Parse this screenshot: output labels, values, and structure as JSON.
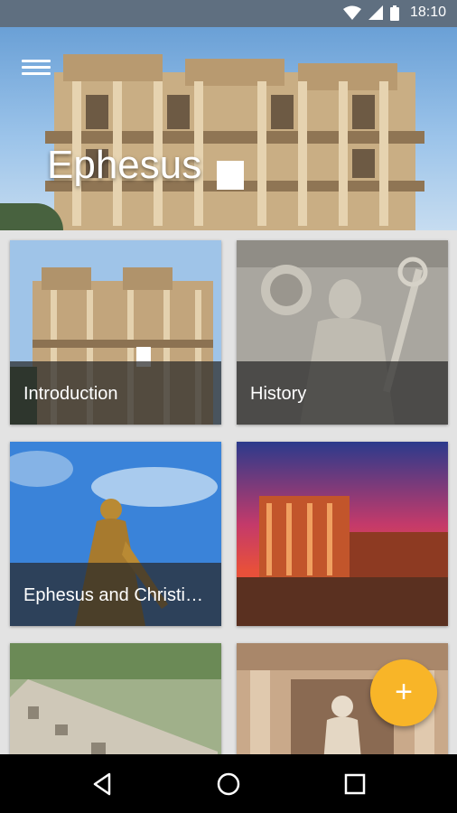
{
  "status_bar": {
    "time": "18:10",
    "icons": [
      "wifi-icon",
      "cellular-signal-icon",
      "battery-icon"
    ]
  },
  "hero": {
    "title": "Ephesus",
    "menu_icon": "hamburger-menu-icon"
  },
  "tiles": [
    {
      "label": "Introduction"
    },
    {
      "label": "History"
    },
    {
      "label": "Ephesus and Christianity"
    },
    {
      "label": ""
    },
    {
      "label": ""
    },
    {
      "label": ""
    }
  ],
  "fab": {
    "label": "+",
    "icon": "add-icon",
    "color": "#f8b528"
  },
  "nav_bar": {
    "icons": [
      "back-icon",
      "home-icon",
      "recents-icon"
    ]
  },
  "colors": {
    "status_bar": "#5f6f80",
    "background": "#e3e3e3",
    "accent": "#f8b528"
  }
}
